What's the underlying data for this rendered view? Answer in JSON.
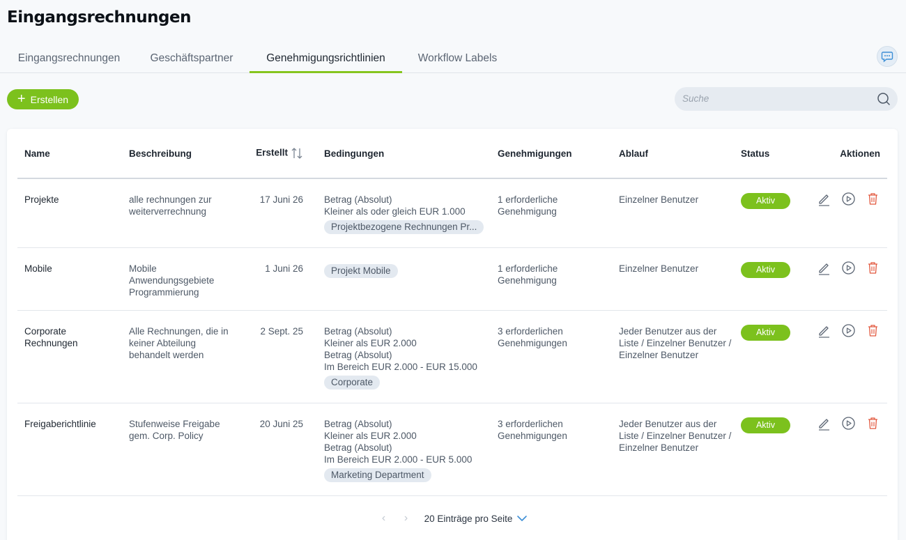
{
  "page": {
    "title": "Eingangsrechnungen"
  },
  "tabs": [
    {
      "label": "Eingangsrechnungen"
    },
    {
      "label": "Geschäftspartner"
    },
    {
      "label": "Genehmigungsrichtlinien"
    },
    {
      "label": "Workflow Labels"
    }
  ],
  "active_tab": "Genehmigungsrichtlinien",
  "toolbar": {
    "create_label": "Erstellen",
    "search_placeholder": "Suche"
  },
  "table": {
    "headers": {
      "name": "Name",
      "beschreibung": "Beschreibung",
      "erstellt": "Erstellt",
      "bedingungen": "Bedingungen",
      "genehmigungen": "Genehmigungen",
      "ablauf": "Ablauf",
      "status": "Status",
      "aktionen": "Aktionen"
    },
    "rows": [
      {
        "name": "Projekte",
        "beschreibung": "alle rechnungen zur weiterverrechnung",
        "erstellt": "17 Juni 26",
        "bedingungen": [
          "Betrag (Absolut)",
          "Kleiner als oder gleich EUR 1.000"
        ],
        "tag": "Projektbezogene Rechnungen Pr...",
        "genehmigungen": "1 erforderliche Genehmigung",
        "ablauf": "Einzelner Benutzer",
        "status": "Aktiv"
      },
      {
        "name": "Mobile",
        "beschreibung": "Mobile Anwendungsgebiete Programmierung",
        "erstellt": "1 Juni 26",
        "bedingungen": [],
        "tag": "Projekt Mobile",
        "genehmigungen": "1 erforderliche Genehmigung",
        "ablauf": "Einzelner Benutzer",
        "status": "Aktiv"
      },
      {
        "name": "Corporate Rechnungen",
        "beschreibung": "Alle Rechnungen, die in keiner Abteilung behandelt werden",
        "erstellt": "2 Sept. 25",
        "bedingungen": [
          "Betrag (Absolut)",
          "Kleiner als EUR 2.000",
          "Betrag (Absolut)",
          "Im Bereich EUR 2.000 - EUR 15.000"
        ],
        "tag": "Corporate",
        "genehmigungen": "3 erforderlichen Genehmigungen",
        "ablauf": "Jeder Benutzer aus der Liste / Einzelner Benutzer / Einzelner Benutzer",
        "status": "Aktiv"
      },
      {
        "name": "Freigaberichtlinie",
        "beschreibung": "Stufenweise Freigabe gem. Corp. Policy",
        "erstellt": "20 Juni 25",
        "bedingungen": [
          "Betrag (Absolut)",
          "Kleiner als EUR 2.000",
          "Betrag (Absolut)",
          "Im Bereich EUR 2.000 - EUR 5.000"
        ],
        "tag": "Marketing Department",
        "genehmigungen": "3 erforderlichen Genehmigungen",
        "ablauf": "Jeder Benutzer aus der Liste / Einzelner Benutzer / Einzelner Benutzer",
        "status": "Aktiv"
      }
    ]
  },
  "pagination": {
    "per_page_label": "20 Einträge pro Seite"
  },
  "colors": {
    "accent": "#7cc11d",
    "delete": "#e2583e",
    "icon": "#5b6573"
  },
  "icons": {
    "create": "plus-icon",
    "search": "search-icon",
    "chat": "chat-icon",
    "sort": "sort-icon",
    "edit": "pencil-icon",
    "run": "play-icon",
    "delete": "trash-icon",
    "prev": "chevron-left-icon",
    "next": "chevron-right-icon",
    "per_page": "chevron-down-icon"
  }
}
